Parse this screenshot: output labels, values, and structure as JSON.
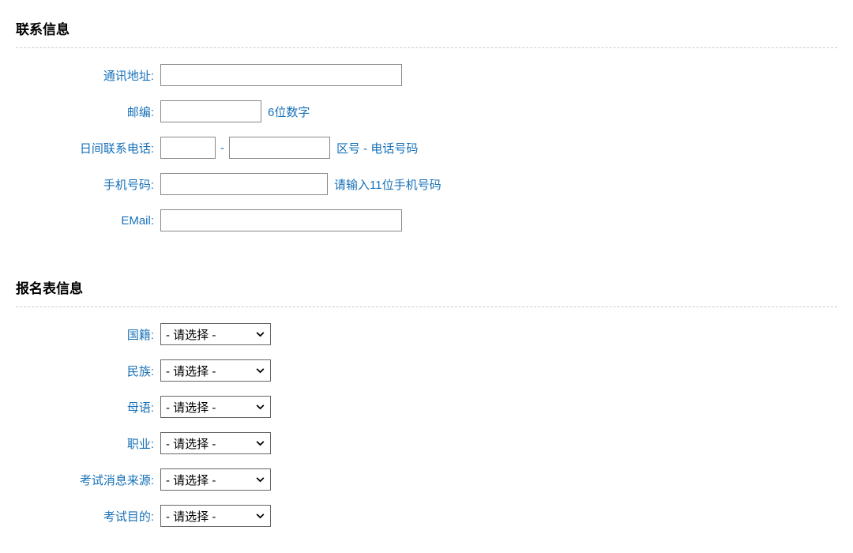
{
  "sections": {
    "contact_title": "联系信息",
    "reginfo_title": "报名表信息"
  },
  "contact": {
    "address_label": "通讯地址:",
    "postcode_label": "邮编:",
    "postcode_hint": "6位数字",
    "dayphone_label": "日间联系电话:",
    "dayphone_hint": "区号 - 电话号码",
    "dash": "-",
    "mobile_label": "手机号码:",
    "mobile_hint": "请输入11位手机号码",
    "email_label": "EMail:"
  },
  "reginfo": {
    "nationality_label": "国籍:",
    "ethnicity_label": "民族:",
    "mother_tongue_label": "母语:",
    "occupation_label": "职业:",
    "exam_source_label": "考试消息来源:",
    "exam_purpose_label": "考试目的:",
    "select_placeholder": "- 请选择 -"
  }
}
